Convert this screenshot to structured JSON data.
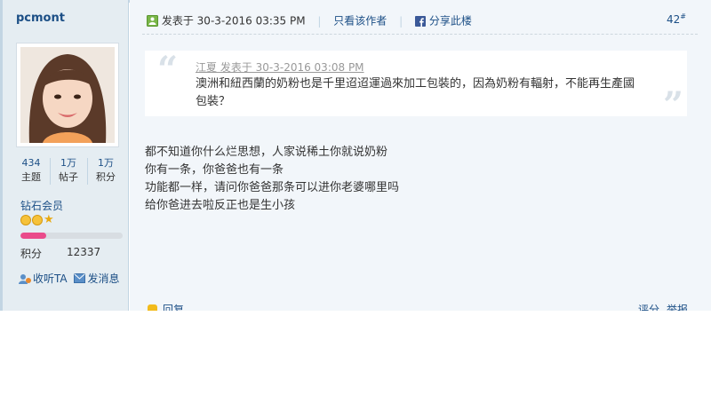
{
  "user": {
    "name": "pcmont",
    "stats": [
      {
        "value": "434",
        "label": "主题"
      },
      {
        "value": "1万",
        "label": "帖子"
      },
      {
        "value": "1万",
        "label": "积分"
      }
    ],
    "rank": "钻石会员",
    "medals": [
      "sun-medal",
      "sun-medal",
      "star-medal"
    ],
    "progress_fraction": 0.25,
    "credits_label": "积分",
    "credits_value": "12337",
    "follow_label": "收听TA",
    "message_label": "发消息"
  },
  "post": {
    "posted_prefix": "发表于",
    "posted_time": "30-3-2016 03:35 PM",
    "author_only": "只看该作者",
    "share": "分享此楼",
    "floor": "42",
    "floor_mark": "#",
    "quote": {
      "author_line": "江夏 发表于 30-3-2016 03:08 PM",
      "text": "澳洲和紐西蘭的奶粉也是千里迢迢運過來加工包裝的，因為奶粉有輻射，不能再生產國包裝？"
    },
    "content": [
      "都不知道你什么烂思想，人家说稀土你就说奶粉",
      "你有一条，你爸爸也有一条",
      "功能都一样，请问你爸爸那条可以进你老婆哪里吗",
      "给你爸进去啦反正也是生小孩"
    ],
    "reply_label": "回复",
    "rate_label": "评分",
    "report_label": "举报"
  },
  "colors": {
    "accent": "#1c4f86",
    "sidebar_bg": "#e5edf2",
    "main_bg": "#f2f6fa",
    "progress": "#ea4b8b"
  }
}
